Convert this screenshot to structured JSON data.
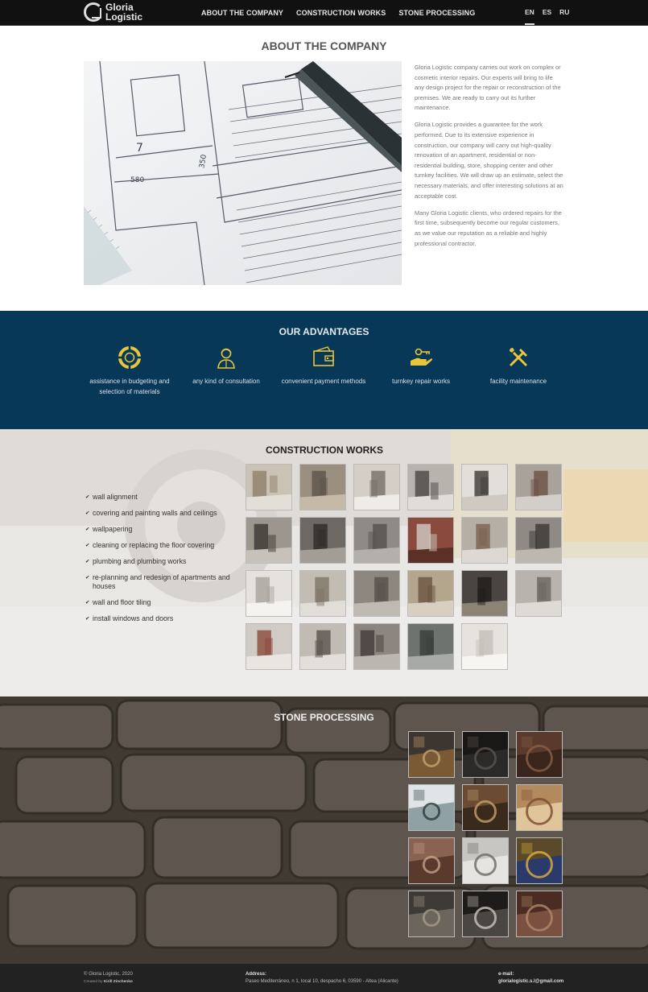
{
  "header": {
    "logo_line1": "Gloria",
    "logo_line2": "Logistic",
    "nav": [
      "ABOUT THE COMPANY",
      "CONSTRUCTION WORKS",
      "STONE PROCESSING"
    ],
    "languages": [
      "EN",
      "ES",
      "RU"
    ],
    "active_language": "EN"
  },
  "about": {
    "title": "ABOUT THE COMPANY",
    "paragraphs": [
      "Gloria Logistic company carries out work on complex or cosmetic interior repairs. Our experts will bring to life any design project for the repair or reconstruction of the premises. We are ready to carry out its further maintenance.",
      "Gloria Logistic provides a guarantee for the work performed. Due to its extensive experience in construction, our company will carry out high-quality renovation of an apartment, residential or non-residential building, store, shopping center and other turnkey facilities. We will draw up an estimate, select the necessary materials, and offer interesting solutions at an acceptable cost.",
      "Many Gloria Logistic clients, who ordered repairs for the first time, subsequently become our regular customers, as we value our reputation as a reliable and highly professional contractor."
    ],
    "image": {
      "blueprint_labels": [
        "7",
        "580",
        "350"
      ]
    }
  },
  "advantages": {
    "title": "OUR ADVANTAGES",
    "items": [
      {
        "icon": "lifebuoy-icon",
        "label": "assistance in budgeting and selection of materials"
      },
      {
        "icon": "consultant-icon",
        "label": "any kind of consultation"
      },
      {
        "icon": "wallet-icon",
        "label": "convenient payment methods"
      },
      {
        "icon": "hand-key-icon",
        "label": "turnkey repair works"
      },
      {
        "icon": "tools-icon",
        "label": "facility maintenance"
      }
    ],
    "icon_color": "#e8c53a"
  },
  "construction": {
    "title": "CONSTRUCTION WORKS",
    "services": [
      "wall alignment",
      "covering and painting walls and ceilings",
      "wallpapering",
      "cleaning or replacing the floor covering",
      "plumbing and plumbing works",
      "re-planning and redesign of apartments and houses",
      "wall and floor tiling",
      "install windows and doors"
    ],
    "photo_count": 23
  },
  "stone": {
    "title": "STONE PROCESSING",
    "photo_count": 12
  },
  "footer": {
    "copyright": "© Gloria Logistic, 2020",
    "credit_prefix": "Created by",
    "credit_name": "Kirill Zinchenko",
    "address_label": "Address:",
    "address": "Paseo Mediterráneo, n 1, local 10, despacho 6, 03590 - Altea (Alicante)",
    "email_label": "e-mail:",
    "email": "glorialogistic.s.l@gmail.com"
  }
}
